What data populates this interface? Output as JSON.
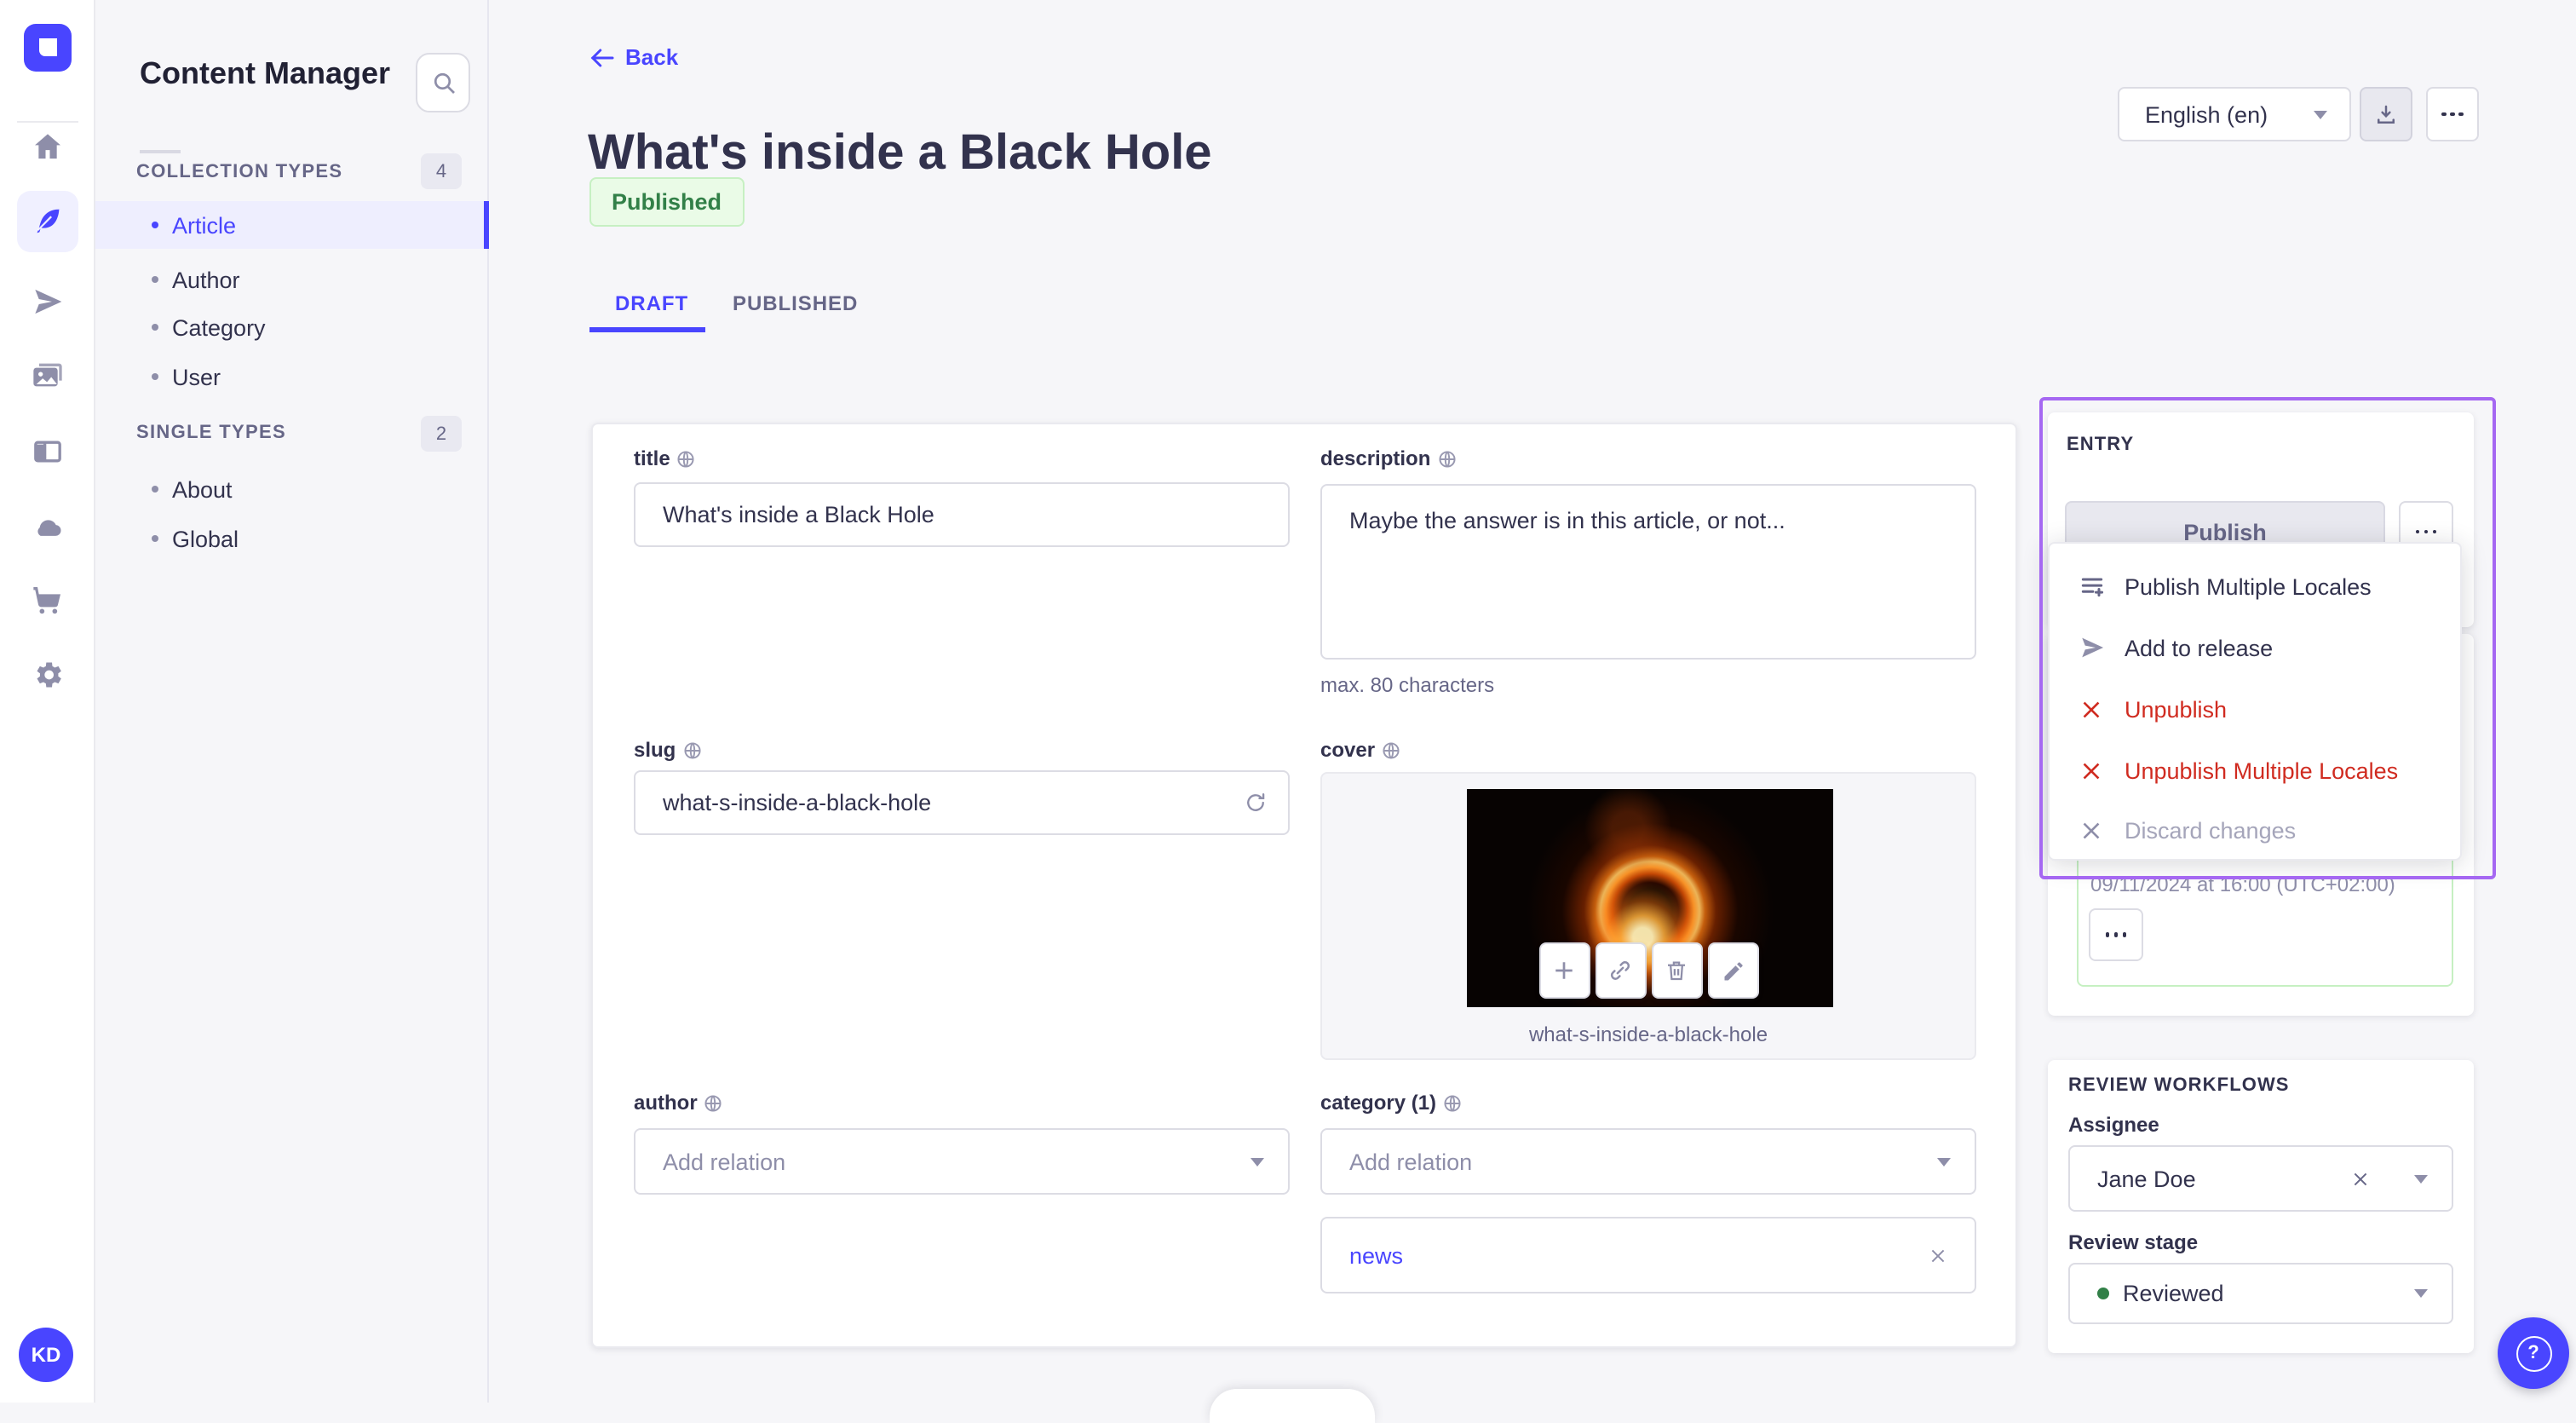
{
  "colors": {
    "accent": "#4945ff",
    "highlight": "#a568f2",
    "danger": "#d02b20",
    "success_text": "#328048",
    "success_bg": "#eafbe7",
    "success_border": "#c6f0c2"
  },
  "rail": {
    "icons": [
      "strapi-logo",
      "home",
      "content-manager-feather",
      "paper-plane",
      "media-images",
      "layout-builder",
      "cloud",
      "marketplace-cart",
      "settings-gear"
    ],
    "avatar_initials": "KD"
  },
  "nav": {
    "title": "Content Manager",
    "sections": [
      {
        "label": "COLLECTION TYPES",
        "count": "4",
        "items": [
          {
            "label": "Article",
            "active": true
          },
          {
            "label": "Author",
            "active": false
          },
          {
            "label": "Category",
            "active": false
          },
          {
            "label": "User",
            "active": false
          }
        ]
      },
      {
        "label": "SINGLE TYPES",
        "count": "2",
        "items": [
          {
            "label": "About",
            "active": false
          },
          {
            "label": "Global",
            "active": false
          }
        ]
      }
    ]
  },
  "header": {
    "back": "Back",
    "title": "What's inside a Black Hole",
    "status": "Published",
    "tabs": [
      {
        "label": "DRAFT",
        "active": true
      },
      {
        "label": "PUBLISHED",
        "active": false
      }
    ],
    "locale": "English (en)"
  },
  "form": {
    "title": {
      "label": "title",
      "value": "What's inside a Black Hole"
    },
    "description": {
      "label": "description",
      "value": "Maybe the answer is in this article, or not...",
      "helper": "max. 80 characters"
    },
    "slug": {
      "label": "slug",
      "value": "what-s-inside-a-black-hole"
    },
    "cover": {
      "label": "cover",
      "caption": "what-s-inside-a-black-hole"
    },
    "author": {
      "label": "author",
      "placeholder": "Add relation"
    },
    "category": {
      "label": "category (1)",
      "placeholder": "Add relation",
      "relation": "news"
    }
  },
  "entry": {
    "heading": "ENTRY",
    "publish_label": "Publish",
    "menu": [
      {
        "label": "Publish Multiple Locales",
        "tone": "default"
      },
      {
        "label": "Add to release",
        "tone": "default"
      },
      {
        "label": "Unpublish",
        "tone": "danger"
      },
      {
        "label": "Unpublish Multiple Locales",
        "tone": "danger"
      },
      {
        "label": "Discard changes",
        "tone": "disabled"
      }
    ],
    "scheduled": "09/11/2024 at 16:00 (UTC+02:00)"
  },
  "review": {
    "heading": "REVIEW WORKFLOWS",
    "assignee_label": "Assignee",
    "assignee": "Jane Doe",
    "stage_label": "Review stage",
    "stage": "Reviewed"
  }
}
